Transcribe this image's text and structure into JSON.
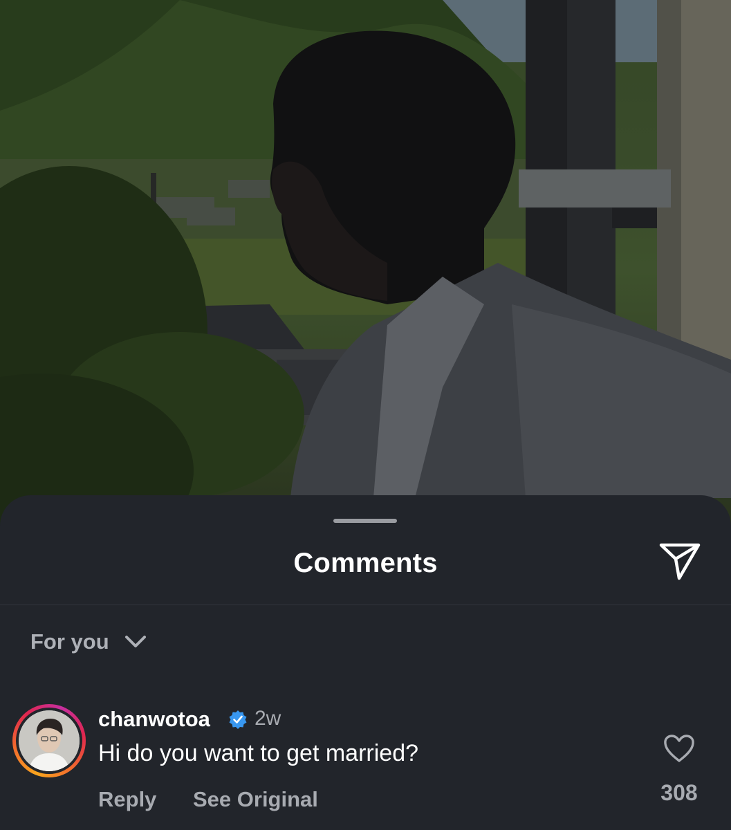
{
  "sheet": {
    "title": "Comments",
    "share_icon": "paper-plane-icon",
    "filter_label": "For you",
    "filter_icon": "chevron-down-icon"
  },
  "comment": {
    "username": "chanwotoa",
    "verified_icon": "verified-badge-icon",
    "time": "2w",
    "text": "Hi do you want to get married?",
    "reply_label": "Reply",
    "see_original_label": "See Original",
    "like_icon": "heart-outline-icon",
    "like_count": "308"
  },
  "colors": {
    "sheet_bg": "#22252b",
    "muted_text": "#a8abb1",
    "verified_blue": "#3897f0",
    "story_ring_start": "#f9a51e",
    "story_ring_end": "#c72f9f"
  }
}
